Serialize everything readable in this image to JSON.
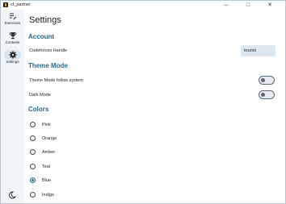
{
  "window": {
    "title": "cf_partner",
    "minimize_icon": "minimize-icon",
    "maximize_icon": "maximize-icon",
    "close_icon": "close-icon"
  },
  "rail": {
    "items": [
      {
        "label": "Exercises",
        "icon": "edit-note-icon"
      },
      {
        "label": "Contests",
        "icon": "trophy-icon"
      },
      {
        "label": "Settings",
        "icon": "gear-icon",
        "active": true
      }
    ],
    "theme_icon": "dark-mode-icon"
  },
  "page": {
    "title": "Settings",
    "account": {
      "heading": "Account",
      "handle_label": "Codeforces Handle",
      "handle_value": "tourist"
    },
    "theme": {
      "heading": "Theme Mode",
      "follow_system_label": "Theme Mode follow system",
      "follow_system_on": false,
      "dark_mode_label": "Dark Mode",
      "dark_mode_on": false
    },
    "colors": {
      "heading": "Colors",
      "options": [
        "Pink",
        "Orange",
        "Amber",
        "Teal",
        "Blue",
        "Indigo"
      ],
      "selected": "Blue"
    }
  },
  "accent_color": "#1e6a8e"
}
